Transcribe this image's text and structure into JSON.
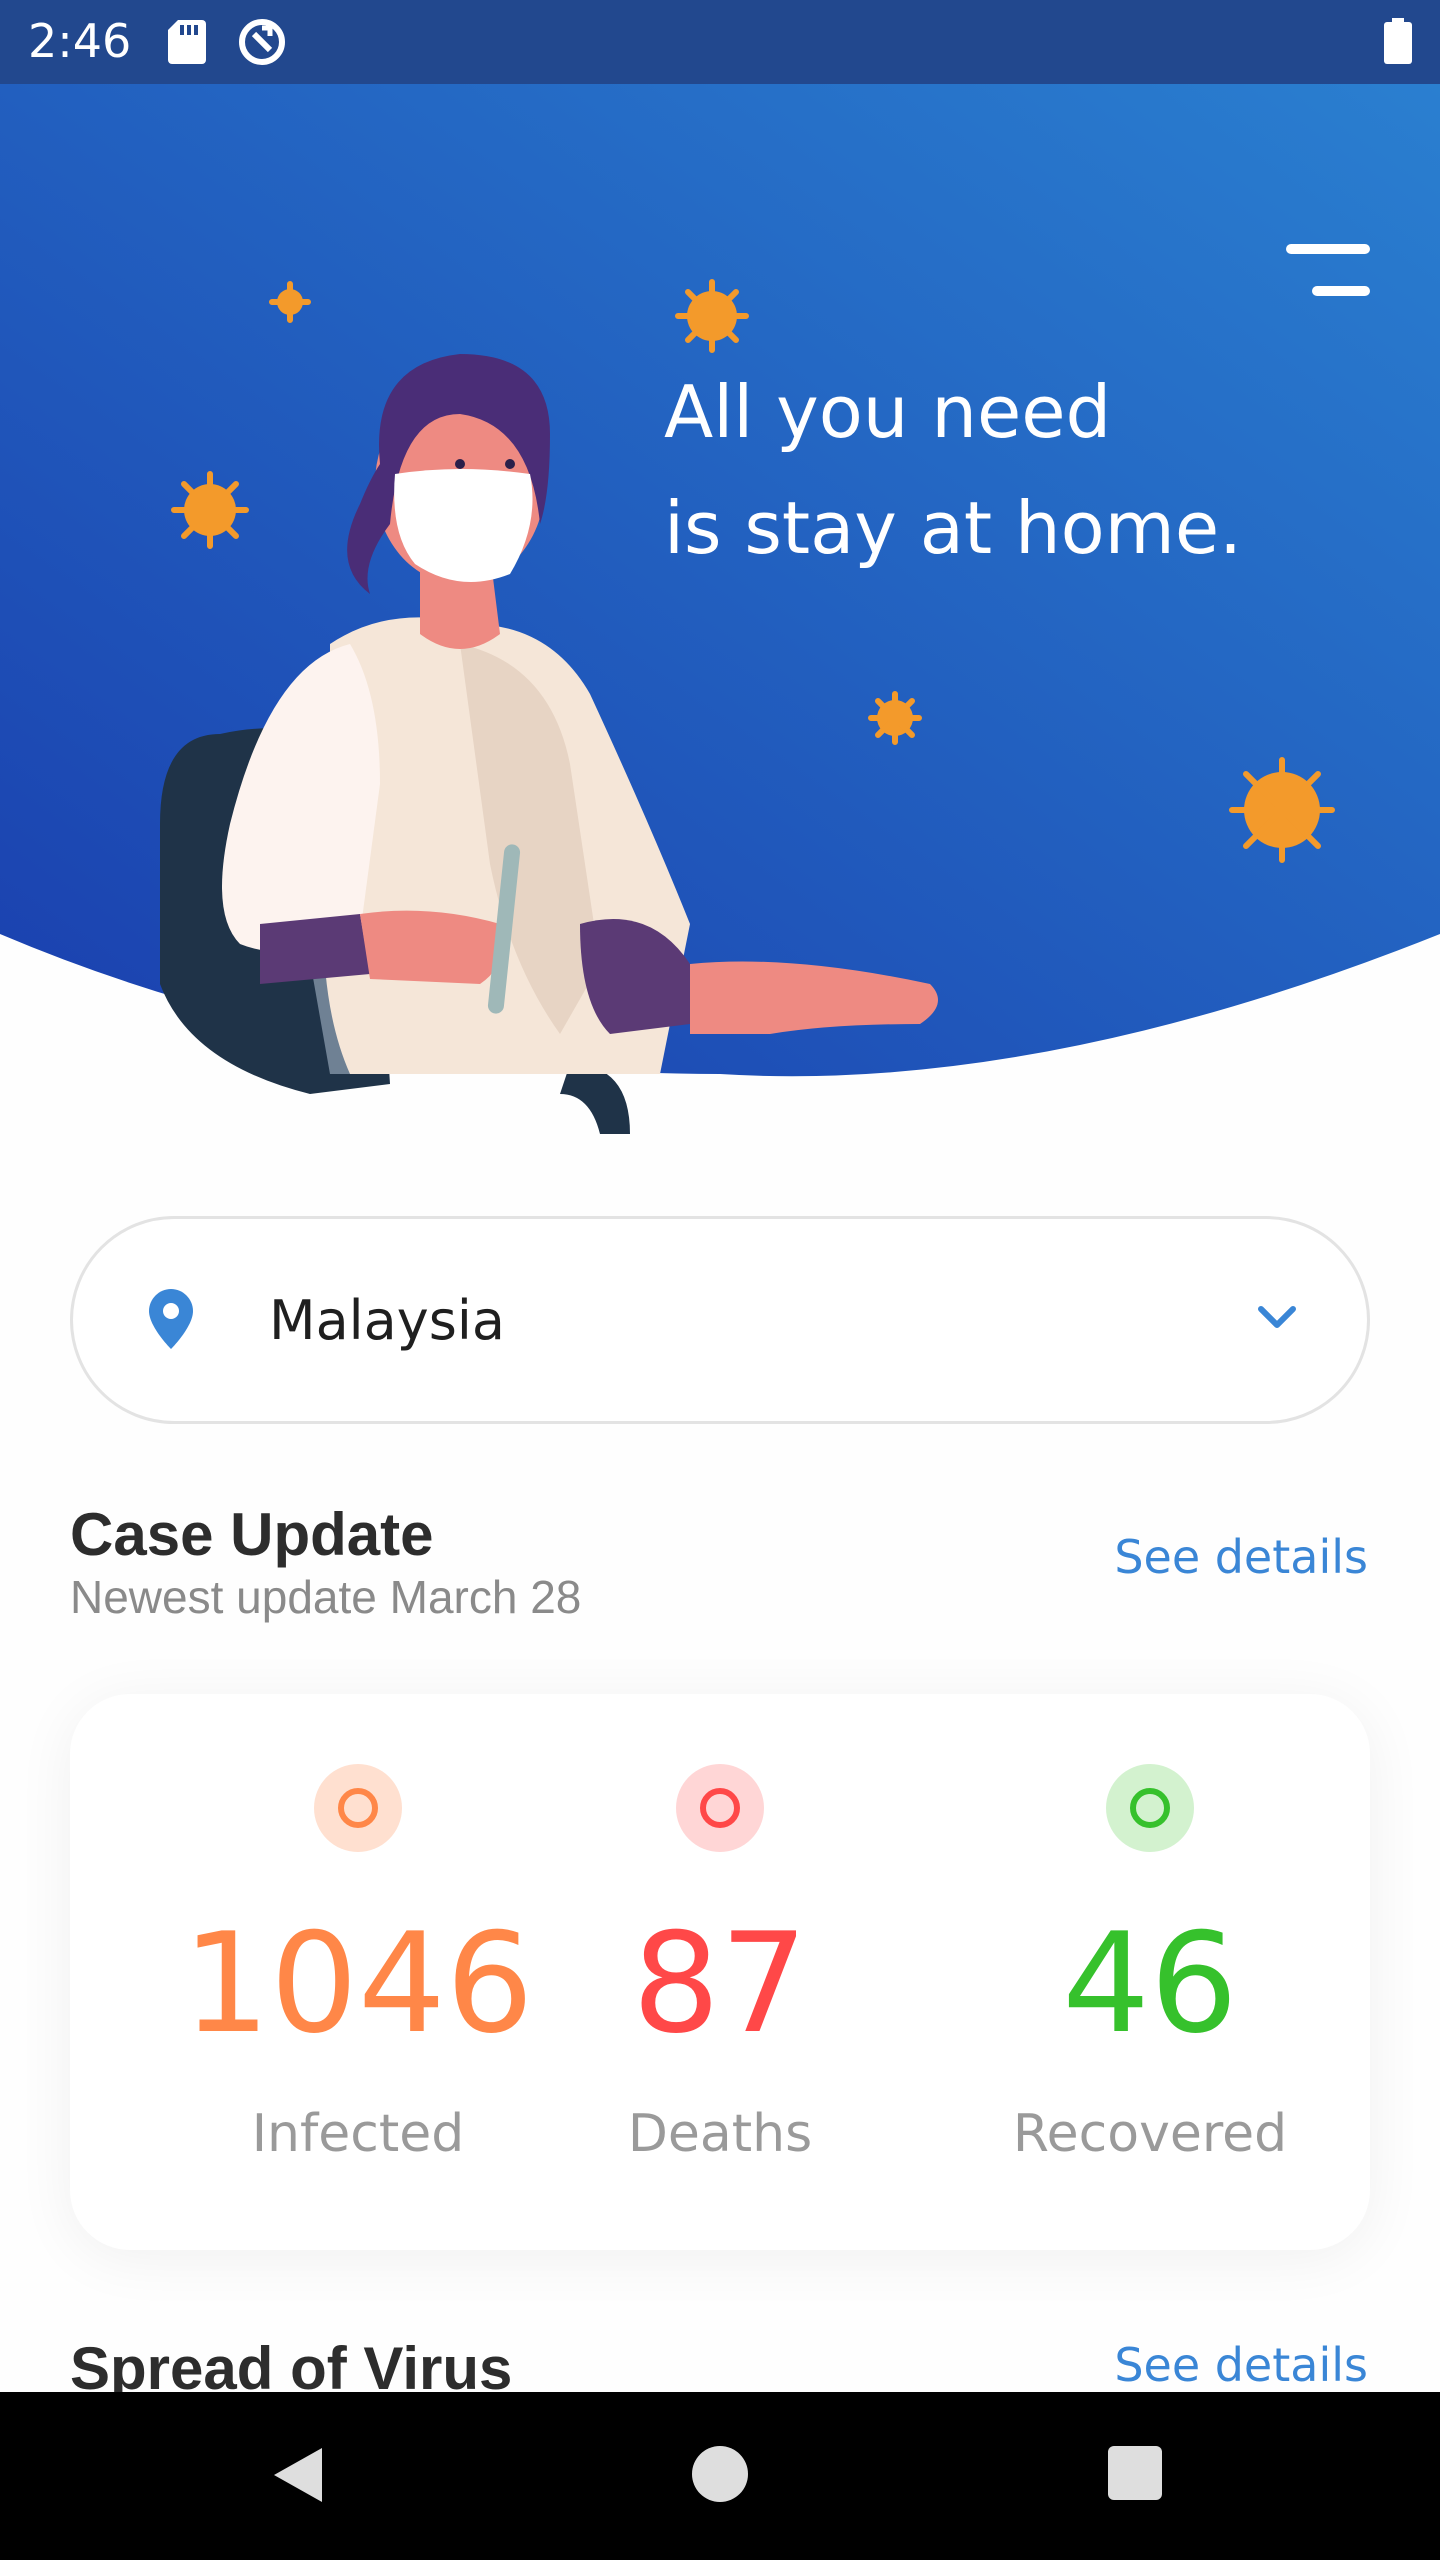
{
  "status_bar": {
    "time": "2:46",
    "icons": [
      "sd-card-icon",
      "sync-icon",
      "battery-icon"
    ]
  },
  "hero": {
    "title_line1": "All you need",
    "title_line2": "is stay at home.",
    "menu_icon": "menu-icon",
    "gradient": [
      "#2a7fd0",
      "#1a3fae"
    ],
    "illustration": "doctor-wearing-mask-illustration"
  },
  "country": {
    "icon": "location-pin-icon",
    "value": "Malaysia",
    "chevron_icon": "chevron-down-icon"
  },
  "case_update": {
    "title": "Case Update",
    "subtitle": "Newest update March 28",
    "see_details": "See details",
    "stats": [
      {
        "value": "1046",
        "label": "Infected",
        "color": "#ff8748"
      },
      {
        "value": "87",
        "label": "Deaths",
        "color": "#ff4848"
      },
      {
        "value": "46",
        "label": "Recovered",
        "color": "#36c12c"
      }
    ]
  },
  "spread": {
    "title": "Spread of Virus",
    "see_details": "See details"
  },
  "nav": {
    "icons": [
      "back-icon",
      "home-icon",
      "recents-icon"
    ]
  },
  "colors": {
    "accent": "#3a86d6",
    "infected": "#ff8748",
    "deaths": "#ff4848",
    "recovered": "#36c12c"
  }
}
